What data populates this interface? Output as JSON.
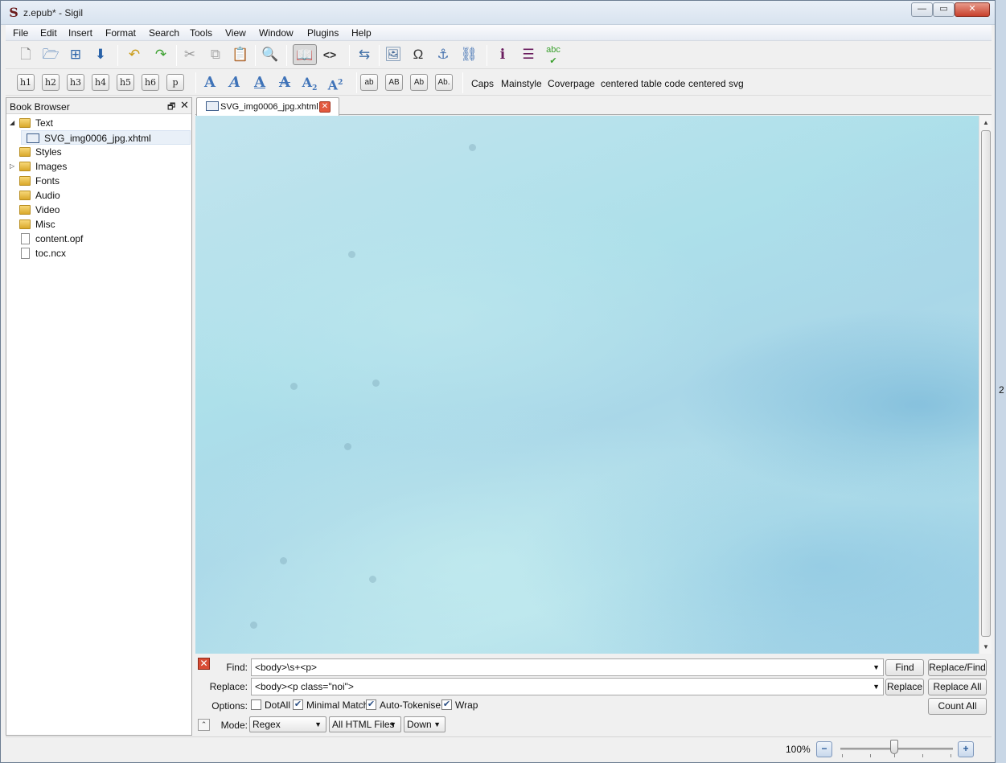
{
  "window": {
    "title": "z.epub* - Sigil",
    "app_icon_glyph": "S"
  },
  "menubar": [
    "File",
    "Edit",
    "Insert",
    "Format",
    "Search",
    "Tools",
    "View",
    "Window",
    "Plugins",
    "Help"
  ],
  "toolbar2": {
    "heading_buttons": [
      "h1",
      "h2",
      "h3",
      "h4",
      "h5",
      "h6",
      "p"
    ],
    "case_buttons": [
      "ab",
      "AB",
      "Ab",
      "Ab."
    ],
    "clip_items": [
      "Caps",
      "Mainstyle",
      "Coverpage",
      "centered table code",
      "centered svg"
    ]
  },
  "book_browser": {
    "title": "Book Browser",
    "tree": [
      {
        "label": "Text",
        "type": "folder",
        "expanded": true
      },
      {
        "label": "SVG_img0006_jpg.xhtml",
        "type": "xhtml",
        "selected": true
      },
      {
        "label": "Styles",
        "type": "folder"
      },
      {
        "label": "Images",
        "type": "folder",
        "collapsed": true
      },
      {
        "label": "Fonts",
        "type": "folder"
      },
      {
        "label": "Audio",
        "type": "folder"
      },
      {
        "label": "Video",
        "type": "folder"
      },
      {
        "label": "Misc",
        "type": "folder"
      },
      {
        "label": "content.opf",
        "type": "file"
      },
      {
        "label": "toc.ncx",
        "type": "file"
      }
    ]
  },
  "editor": {
    "tab_label": "SVG_img0006_jpg.xhtml"
  },
  "find_replace": {
    "find_label": "Find:",
    "find_value": "<body>\\s+<p>",
    "replace_label": "Replace:",
    "replace_value": "<body><p class=\"noi\">",
    "options_label": "Options:",
    "mode_label": "Mode:",
    "options": [
      {
        "label": "DotAll",
        "checked": false
      },
      {
        "label": "Minimal Match",
        "checked": true
      },
      {
        "label": "Auto-Tokenise",
        "checked": true
      },
      {
        "label": "Wrap",
        "checked": true
      }
    ],
    "buttons": {
      "find": "Find",
      "replace_find": "Replace/Find",
      "replace": "Replace",
      "replace_all": "Replace All",
      "count_all": "Count All"
    },
    "mode": "Regex",
    "scope": "All HTML Files",
    "direction": "Down"
  },
  "statusbar": {
    "zoom": "100%",
    "zoom_level_fraction": 0.5
  },
  "right_edge_text": "2",
  "colors": {
    "accent": "#2a62a8",
    "close_red": "#d84c35"
  }
}
